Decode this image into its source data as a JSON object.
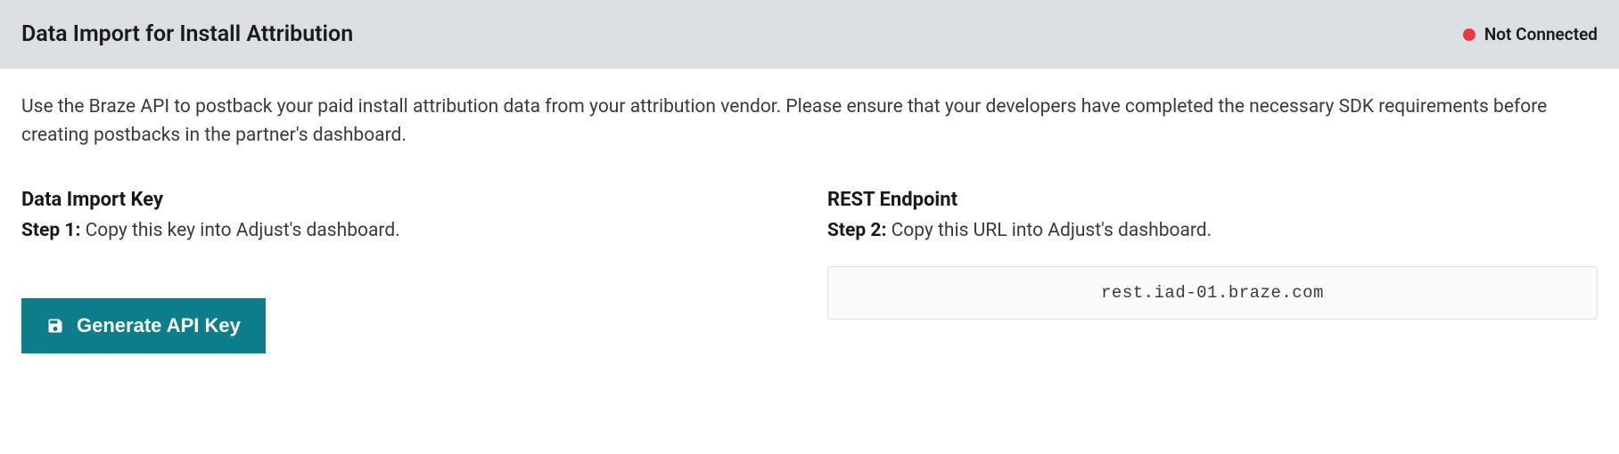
{
  "header": {
    "title": "Data Import for Install Attribution",
    "status_text": "Not Connected",
    "status_color": "#e63946"
  },
  "description": "Use the Braze API to postback your paid install attribution data from your attribution vendor. Please ensure that your developers have completed the necessary SDK requirements before creating postbacks in the partner's dashboard.",
  "data_import_key": {
    "title": "Data Import Key",
    "step_label": "Step 1:",
    "step_text": " Copy this key into Adjust's dashboard.",
    "button_label": "Generate API Key"
  },
  "rest_endpoint": {
    "title": "REST Endpoint",
    "step_label": "Step 2:",
    "step_text": " Copy this URL into Adjust's dashboard.",
    "value": "rest.iad-01.braze.com"
  }
}
